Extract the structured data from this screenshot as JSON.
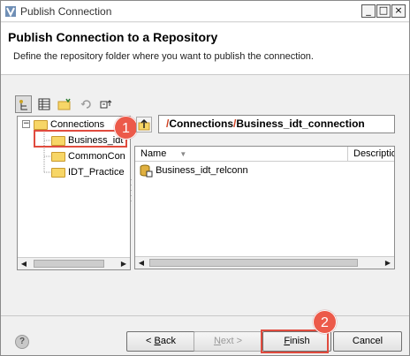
{
  "window": {
    "title": "Publish Connection",
    "minimize_glyph": "_",
    "maximize_glyph": "□",
    "close_glyph": "×"
  },
  "header": {
    "title": "Publish Connection to a Repository",
    "description": "Define the repository folder where you want to publish the connection."
  },
  "tree": {
    "root": {
      "label": "Connections",
      "expander": "−"
    },
    "items": [
      {
        "label": "Business_idt",
        "selected": true
      },
      {
        "label": "CommonCon"
      },
      {
        "label": "IDT_Practice"
      }
    ]
  },
  "path": {
    "sep1": "/",
    "seg1": "Connections",
    "sep2": "/",
    "seg2": "Business_idt_connection"
  },
  "list": {
    "columns": [
      "Name",
      "Description"
    ],
    "sort_glyph": "▼",
    "rows": [
      {
        "name": "Business_idt_relconn",
        "icon": "relational-connection-icon"
      }
    ]
  },
  "annotations": {
    "badge1": "1",
    "badge2": "2",
    "highlight_color": "#e04b3e"
  },
  "buttons": {
    "back_prefix": "< ",
    "back_mnemonic": "B",
    "back_rest": "ack",
    "next_mnemonic": "N",
    "next_rest": "ext >",
    "finish_mnemonic": "F",
    "finish_rest": "inish",
    "cancel": "Cancel"
  },
  "help": {
    "glyph": "?"
  }
}
